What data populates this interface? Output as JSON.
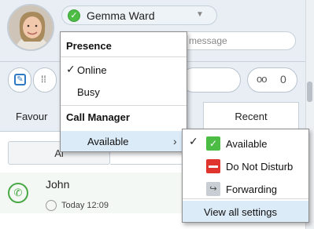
{
  "header": {
    "user_name": "Gemma Ward",
    "status_message_placeholder": "message"
  },
  "toolbar": {
    "voicemail_count": "0"
  },
  "tabs": {
    "favourites_label": "Favour",
    "recent_label": "Recent"
  },
  "filters": {
    "all_label": "Al"
  },
  "recent_calls": [
    {
      "name": "John",
      "time": "Today 12:09"
    }
  ],
  "presence_menu": {
    "presence_heading": "Presence",
    "online_label": "Online",
    "busy_label": "Busy",
    "call_manager_heading": "Call Manager",
    "available_label": "Available",
    "checkmark": "✓",
    "submenu_arrow": "›"
  },
  "call_manager_submenu": {
    "items": [
      {
        "label": "Available",
        "icon": "available-check-icon",
        "checked": true
      },
      {
        "label": "Do Not Disturb",
        "icon": "do-not-disturb-icon"
      },
      {
        "label": "Forwarding",
        "icon": "forwarding-icon"
      }
    ],
    "view_all_settings_label": "View all settings"
  },
  "colors": {
    "available_green": "#4cbc45",
    "dnd_red": "#e0342f",
    "highlight": "#dcebf8",
    "accent_blue": "#2e78c4"
  }
}
